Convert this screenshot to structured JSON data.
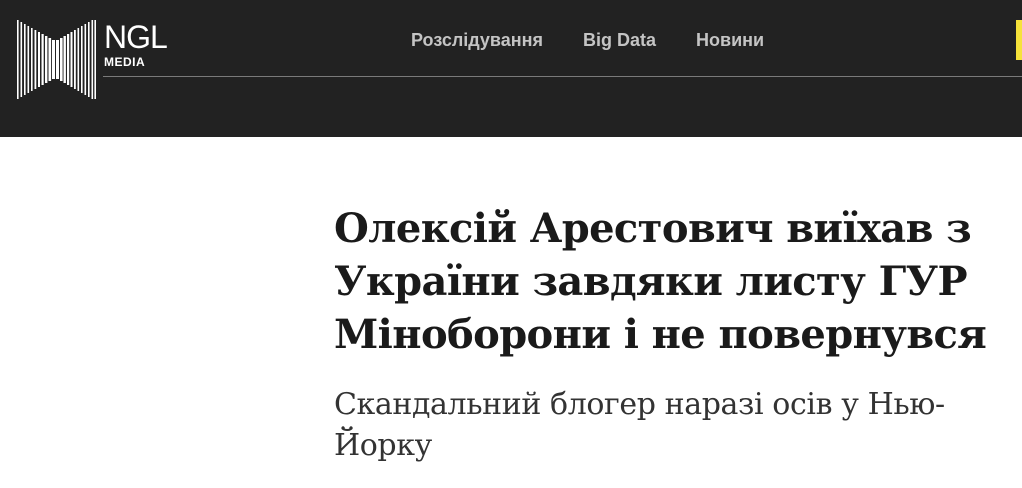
{
  "header": {
    "logo": {
      "name": "NGL",
      "sub": "MEDIA"
    },
    "nav": [
      {
        "label": "Розслідування"
      },
      {
        "label": "Big Data"
      },
      {
        "label": "Новини"
      }
    ],
    "accent_color": "#f6e23a",
    "background_color": "#222222"
  },
  "article": {
    "headline_lines": [
      "Олексій Арестович виїхав з",
      "України завдяки листу ГУР",
      "Міноборони і не повернувся"
    ],
    "subheadline_lines": [
      "Скандальний блогер наразі осів у Нью-",
      "Йорку"
    ]
  }
}
